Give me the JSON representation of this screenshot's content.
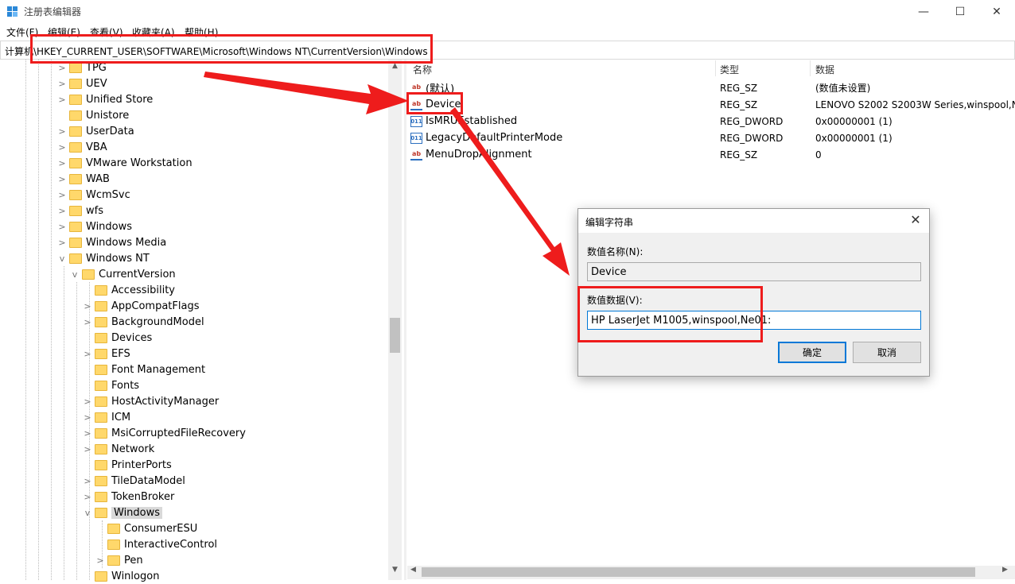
{
  "window": {
    "title": "注册表编辑器",
    "minimize_icon": "minimize-icon",
    "maximize_icon": "maximize-icon",
    "close_icon": "close-icon"
  },
  "menu": [
    "文件(F)",
    "编辑(E)",
    "查看(V)",
    "收藏夹(A)",
    "帮助(H)"
  ],
  "address": {
    "path": "计算机\\HKEY_CURRENT_USER\\SOFTWARE\\Microsoft\\Windows NT\\CurrentVersion\\Windows"
  },
  "tree": [
    {
      "label": "TPG",
      "expand": ">"
    },
    {
      "label": "UEV",
      "expand": ">"
    },
    {
      "label": "Unified Store",
      "expand": ">"
    },
    {
      "label": "Unistore",
      "expand": ""
    },
    {
      "label": "UserData",
      "expand": ">"
    },
    {
      "label": "VBA",
      "expand": ">"
    },
    {
      "label": "VMware Workstation",
      "expand": ">"
    },
    {
      "label": "WAB",
      "expand": ">"
    },
    {
      "label": "WcmSvc",
      "expand": ">"
    },
    {
      "label": "wfs",
      "expand": ">"
    },
    {
      "label": "Windows",
      "expand": ">"
    },
    {
      "label": "Windows Media",
      "expand": ">"
    },
    {
      "label": "Windows NT",
      "expand": "v"
    },
    {
      "label": "CurrentVersion",
      "expand": "v"
    },
    {
      "label": "Accessibility",
      "expand": ""
    },
    {
      "label": "AppCompatFlags",
      "expand": ">"
    },
    {
      "label": "BackgroundModel",
      "expand": ">"
    },
    {
      "label": "Devices",
      "expand": ""
    },
    {
      "label": "EFS",
      "expand": ">"
    },
    {
      "label": "Font Management",
      "expand": ""
    },
    {
      "label": "Fonts",
      "expand": ""
    },
    {
      "label": "HostActivityManager",
      "expand": ">"
    },
    {
      "label": "ICM",
      "expand": ">"
    },
    {
      "label": "MsiCorruptedFileRecovery",
      "expand": ">"
    },
    {
      "label": "Network",
      "expand": ">"
    },
    {
      "label": "PrinterPorts",
      "expand": ""
    },
    {
      "label": "TileDataModel",
      "expand": ">"
    },
    {
      "label": "TokenBroker",
      "expand": ">"
    },
    {
      "label": "Windows",
      "expand": "v"
    },
    {
      "label": "ConsumerESU",
      "expand": ""
    },
    {
      "label": "InteractiveControl",
      "expand": ""
    },
    {
      "label": "Pen",
      "expand": ">"
    },
    {
      "label": "Winlogon",
      "expand": ""
    }
  ],
  "list": {
    "headers": {
      "name": "名称",
      "type": "类型",
      "data": "数据"
    },
    "rows": [
      {
        "name": "(默认)",
        "type": "REG_SZ",
        "data": "(数值未设置)",
        "icon": "string-value-icon"
      },
      {
        "name": "Device",
        "type": "REG_SZ",
        "data": "LENOVO S2002 S2003W Series,winspool,N",
        "icon": "string-value-icon"
      },
      {
        "name": "IsMRUEstablished",
        "type": "REG_DWORD",
        "data": "0x00000001 (1)",
        "icon": "dword-value-icon"
      },
      {
        "name": "LegacyDefaultPrinterMode",
        "type": "REG_DWORD",
        "data": "0x00000001 (1)",
        "icon": "dword-value-icon"
      },
      {
        "name": "MenuDropAlignment",
        "type": "REG_SZ",
        "data": "0",
        "icon": "string-value-icon"
      }
    ]
  },
  "dialog": {
    "title": "编辑字符串",
    "name_label": "数值名称(N):",
    "name_value": "Device",
    "data_label": "数值数据(V):",
    "data_value": "HP LaserJet M1005,winspool,Ne01:",
    "ok_label": "确定",
    "cancel_label": "取消"
  },
  "annotation_color": "#ee1c1c"
}
